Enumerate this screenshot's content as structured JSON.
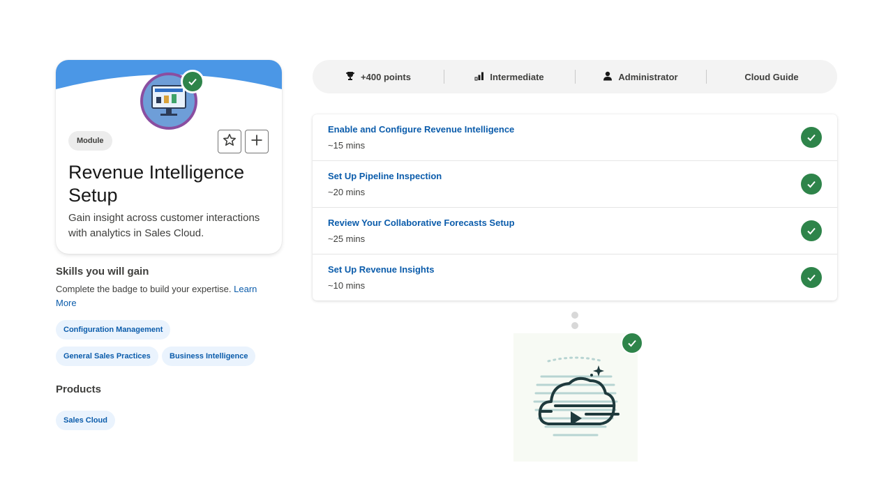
{
  "module": {
    "type_label": "Module",
    "title": "Revenue Intelligence Setup",
    "description": "Gain insight across customer interactions with analytics in Sales Cloud."
  },
  "skills": {
    "heading": "Skills you will gain",
    "text": "Complete the badge to build your expertise.",
    "link": "Learn More",
    "tags": [
      "Configuration Management",
      "General Sales Practices",
      "Business Intelligence"
    ]
  },
  "products": {
    "heading": "Products",
    "tags": [
      "Sales Cloud"
    ]
  },
  "stats": {
    "points": "+400 points",
    "level": "Intermediate",
    "role": "Administrator",
    "guide": "Cloud Guide"
  },
  "units": [
    {
      "title": "Enable and Configure Revenue Intelligence",
      "time": "~15 mins"
    },
    {
      "title": "Set Up Pipeline Inspection",
      "time": "~20 mins"
    },
    {
      "title": "Review Your Collaborative Forecasts Setup",
      "time": "~25 mins"
    },
    {
      "title": "Set Up Revenue Insights",
      "time": "~10 mins"
    }
  ],
  "colors": {
    "accent_blue": "#0b5cab",
    "banner_blue": "#4b97e6",
    "success_green": "#2e844a",
    "badge_border": "#8a4ea0"
  },
  "icons": {
    "points": "trophy-icon",
    "level": "signal-bars-icon",
    "role": "user-icon",
    "favorite": "star-icon",
    "add": "plus-icon",
    "complete": "check-icon"
  }
}
